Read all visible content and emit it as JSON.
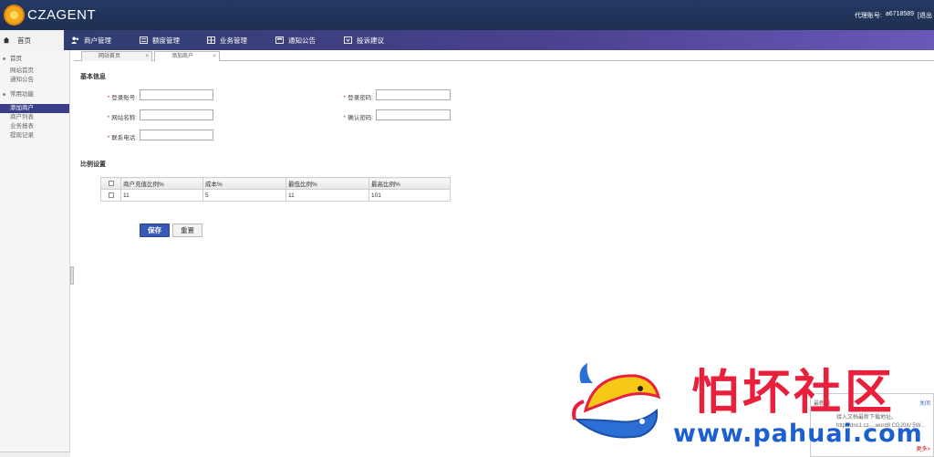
{
  "header": {
    "brand": "CZAGENT",
    "account_label": "代理账号:",
    "account_value": "a6718589",
    "logout": "[退出"
  },
  "nav": {
    "home": "首页",
    "items": [
      {
        "label": "商户管理",
        "icon": "users-icon"
      },
      {
        "label": "额度管理",
        "icon": "quota-icon"
      },
      {
        "label": "业务管理",
        "icon": "grid-icon"
      },
      {
        "label": "通知公告",
        "icon": "notice-icon"
      },
      {
        "label": "投诉建议",
        "icon": "feedback-icon"
      }
    ]
  },
  "sidebar": {
    "groups": [
      {
        "title": "首页",
        "items": [
          "网站首页",
          "通知公告"
        ]
      },
      {
        "title": "常用功能",
        "items": [
          "添加商户",
          "商户列表",
          "业务报表",
          "提现记录"
        ]
      }
    ],
    "active_item": "添加商户"
  },
  "tabs": [
    {
      "label": "网站首页",
      "close": "×"
    },
    {
      "label": "添加商户",
      "close": "×"
    }
  ],
  "form": {
    "section_basic": "基本信息",
    "required_mark": "*",
    "login_account": "登录账号:",
    "login_password": "登录密码:",
    "site_name": "网站名称:",
    "confirm_password": "确认密码:",
    "contact_phone": "联系电话:",
    "section_ratio": "比例设置"
  },
  "ratio_table": {
    "headers": [
      "商户充值比例%",
      "成本%",
      "最低比例%",
      "最高比例%"
    ],
    "rows": [
      [
        "11",
        "5",
        "11",
        "101"
      ]
    ]
  },
  "buttons": {
    "save": "保存",
    "reset": "重置"
  },
  "notice": {
    "title": "最新通",
    "close": "关闭",
    "body": "接入文档最新下载地址。http://dns1.cz-...word8 CGJ0X/ 5W...",
    "foot": "更多>"
  },
  "watermark": {
    "cn": "怕坏社区",
    "url": "www.pahuai.com"
  },
  "colors": {
    "header_bg": "#1d2f52",
    "active_sidebar": "#3b3f8a",
    "save_button": "#3859b6",
    "watermark_red": "#e8203c",
    "watermark_blue": "#1c5fd0"
  }
}
